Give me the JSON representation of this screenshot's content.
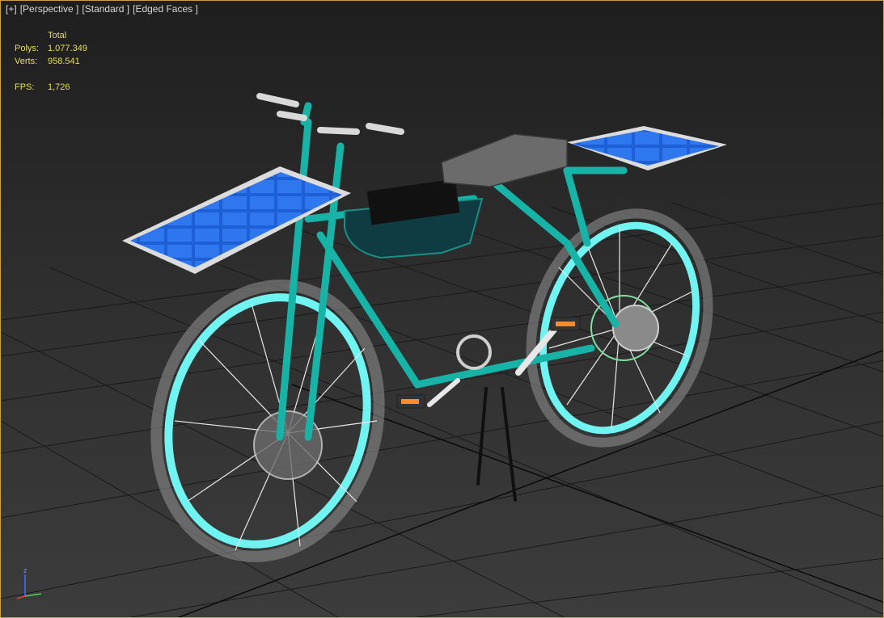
{
  "viewport": {
    "labels": [
      "[+]",
      "[Perspective ]",
      "[Standard ]",
      "[Edged Faces ]"
    ]
  },
  "stats": {
    "header": "Total",
    "polys_label": "Polys:",
    "polys_value": "1.077.349",
    "verts_label": "Verts:",
    "verts_value": "958.541",
    "fps_label": "FPS:",
    "fps_value": "1,726"
  },
  "colors": {
    "frame": "#17b3a6",
    "tire_glow": "#6ff4f1",
    "solar_panel": "#1e5fd6",
    "seat": "#6b6b6b",
    "battery": "#0f3b42",
    "grid": "#1a1a1a",
    "viewport_border": "#c9a23a",
    "stats_text": "#e8df5a"
  },
  "gizmo": {
    "z_label": "z"
  }
}
